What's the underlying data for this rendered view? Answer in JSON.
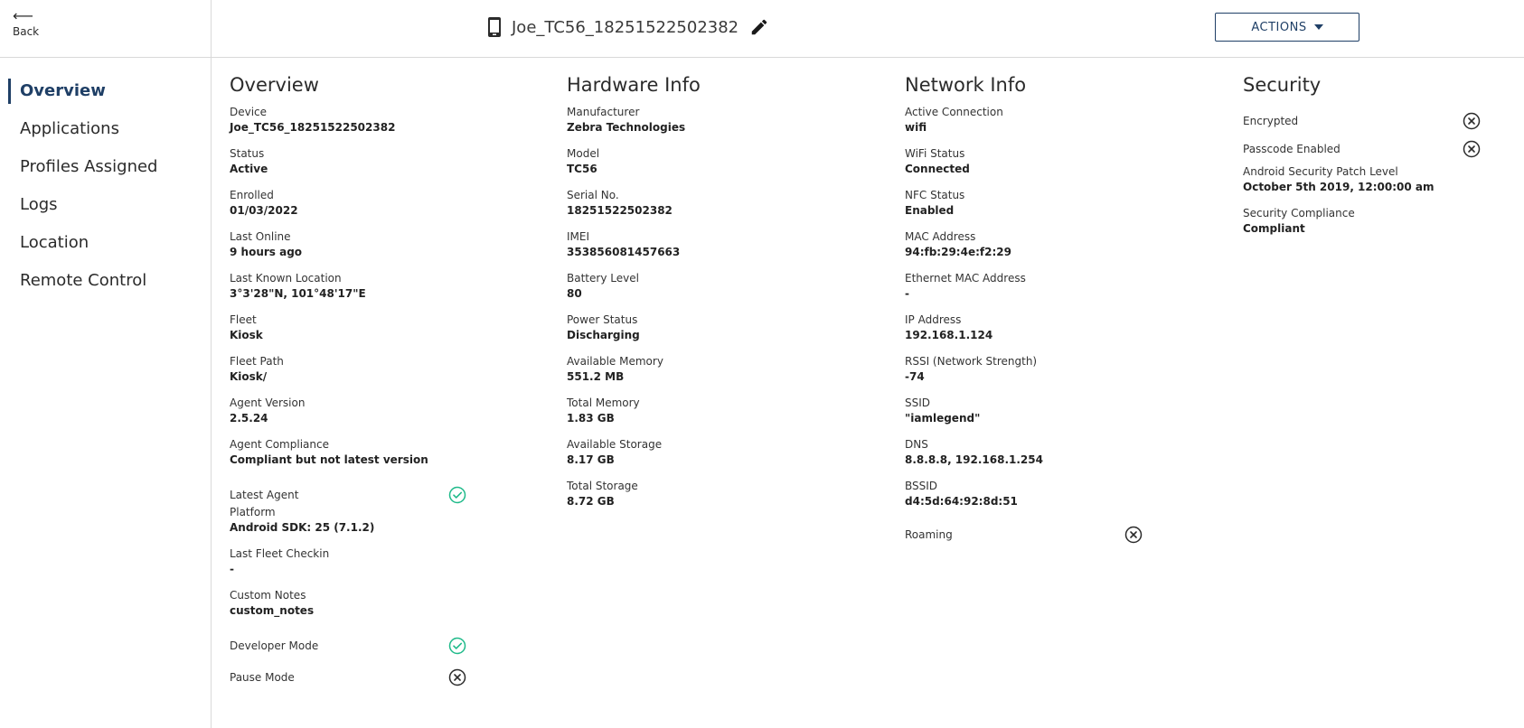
{
  "nav": {
    "back_arrow": "⟵",
    "back_label": "Back",
    "items": [
      {
        "label": "Overview",
        "active": true
      },
      {
        "label": "Applications"
      },
      {
        "label": "Profiles Assigned"
      },
      {
        "label": "Logs"
      },
      {
        "label": "Location"
      },
      {
        "label": "Remote Control"
      }
    ]
  },
  "header": {
    "device_name": "Joe_TC56_18251522502382",
    "actions_label": "ACTIONS"
  },
  "colors": {
    "accent": "#1f3f66",
    "check_green": "#1fba8a",
    "cross_dark": "#2b2b2b"
  },
  "overview": {
    "title": "Overview",
    "fields": [
      {
        "label": "Device",
        "value": "Joe_TC56_18251522502382"
      },
      {
        "label": "Status",
        "value": "Active"
      },
      {
        "label": "Enrolled",
        "value": "01/03/2022"
      },
      {
        "label": "Last Online",
        "value": "9 hours ago"
      },
      {
        "label": "Last Known Location",
        "value": "3°3'28\"N, 101°48'17\"E"
      },
      {
        "label": "Fleet",
        "value": "Kiosk"
      },
      {
        "label": "Fleet Path",
        "value": "Kiosk/"
      },
      {
        "label": "Agent Version",
        "value": "2.5.24"
      },
      {
        "label": "Agent Compliance",
        "value": "Compliant but not latest version"
      }
    ],
    "latest_agent": {
      "label": "Latest Agent",
      "icon": "check-circle-icon"
    },
    "fields2": [
      {
        "label": "Platform",
        "value": "Android SDK: 25 (7.1.2)"
      },
      {
        "label": "Last Fleet Checkin",
        "value": "-"
      },
      {
        "label": "Custom Notes",
        "value": "custom_notes"
      }
    ],
    "developer_mode": {
      "label": "Developer Mode",
      "icon": "check-circle-icon"
    },
    "pause_mode": {
      "label": "Pause Mode",
      "icon": "x-circle-icon"
    }
  },
  "hardware": {
    "title": "Hardware Info",
    "fields": [
      {
        "label": "Manufacturer",
        "value": "Zebra Technologies"
      },
      {
        "label": "Model",
        "value": "TC56"
      },
      {
        "label": "Serial No.",
        "value": "18251522502382"
      },
      {
        "label": "IMEI",
        "value": "353856081457663"
      },
      {
        "label": "Battery Level",
        "value": "80"
      },
      {
        "label": "Power Status",
        "value": "Discharging"
      },
      {
        "label": "Available Memory",
        "value": "551.2 MB"
      },
      {
        "label": "Total Memory",
        "value": "1.83 GB"
      },
      {
        "label": "Available Storage",
        "value": "8.17 GB"
      },
      {
        "label": "Total Storage",
        "value": "8.72 GB"
      }
    ]
  },
  "network": {
    "title": "Network Info",
    "fields": [
      {
        "label": "Active Connection",
        "value": "wifi"
      },
      {
        "label": "WiFi Status",
        "value": "Connected"
      },
      {
        "label": "NFC Status",
        "value": "Enabled"
      },
      {
        "label": "MAC Address",
        "value": "94:fb:29:4e:f2:29"
      },
      {
        "label": "Ethernet MAC Address",
        "value": "-"
      },
      {
        "label": "IP Address",
        "value": "192.168.1.124"
      },
      {
        "label": "RSSI (Network Strength)",
        "value": "-74"
      },
      {
        "label": "SSID",
        "value": "\"iamlegend\""
      },
      {
        "label": "DNS",
        "value": "8.8.8.8, 192.168.1.254"
      },
      {
        "label": "BSSID",
        "value": "d4:5d:64:92:8d:51"
      }
    ],
    "roaming": {
      "label": "Roaming",
      "icon": "x-circle-icon"
    }
  },
  "security": {
    "title": "Security",
    "encrypted": {
      "label": "Encrypted",
      "icon": "x-circle-icon"
    },
    "passcode": {
      "label": "Passcode Enabled",
      "icon": "x-circle-icon"
    },
    "fields": [
      {
        "label": "Android Security Patch Level",
        "value": "October 5th 2019, 12:00:00 am"
      },
      {
        "label": "Security Compliance",
        "value": "Compliant"
      }
    ]
  }
}
